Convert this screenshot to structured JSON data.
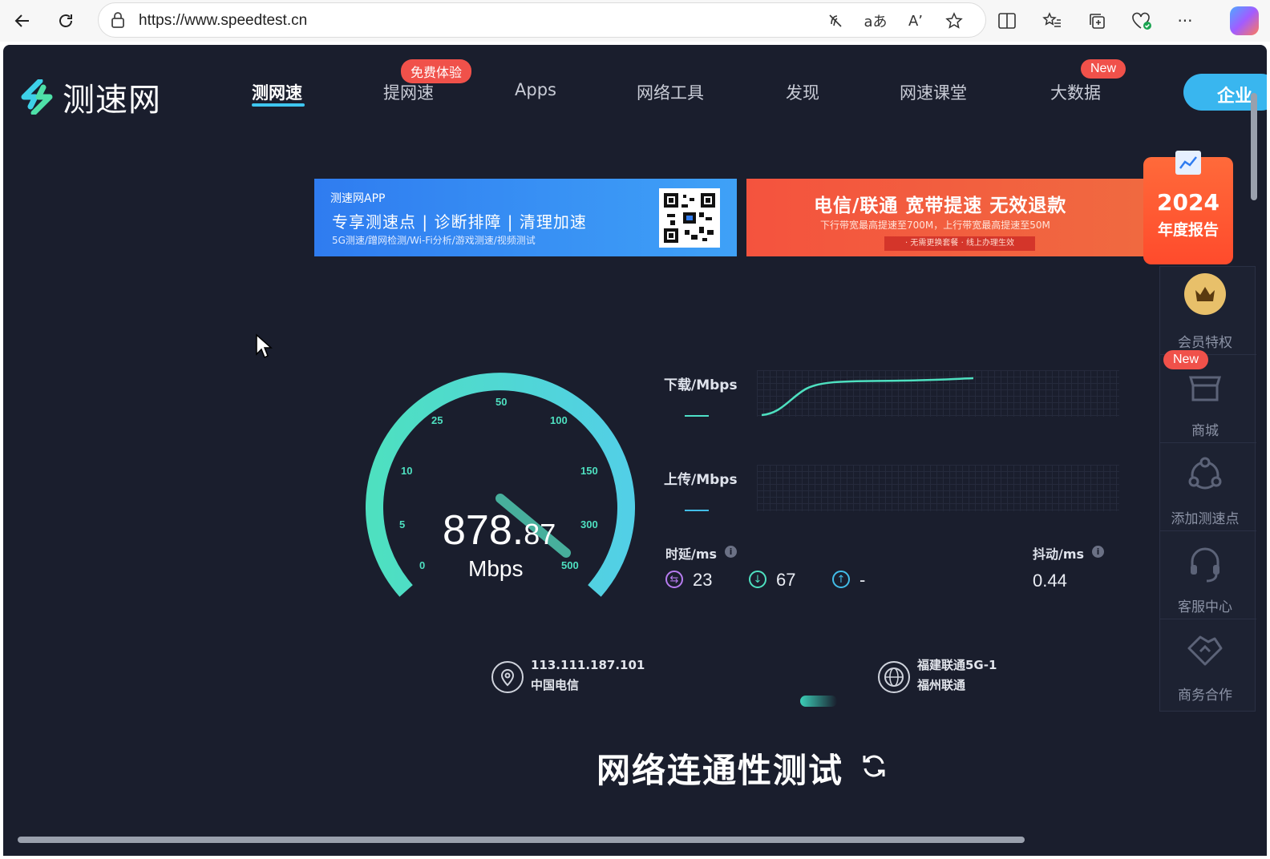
{
  "browser": {
    "url": "https://www.speedtest.cn",
    "icons": [
      "back-icon",
      "refresh-icon",
      "lock-icon",
      "tracking-icon",
      "translate-icon",
      "read-aloud-icon",
      "favorite-icon",
      "split-screen-icon",
      "favorites-icon",
      "collections-icon",
      "health-icon",
      "more-icon",
      "copilot-icon"
    ],
    "translate_glyph": "aあ",
    "read_glyph": "A’",
    "more_glyph": "···"
  },
  "site": {
    "logo_text": "测速网",
    "nav": [
      "测网速",
      "提网速",
      "Apps",
      "网络工具",
      "发现",
      "网速课堂",
      "大数据"
    ],
    "badge_free": "免费体验",
    "badge_new": "New",
    "enterprise": "企业"
  },
  "banners": {
    "blue": {
      "app": "测速网APP",
      "main": "专享测速点 | 诊断排障 | 清理加速",
      "sub": "5G测速/蹭网检测/Wi-Fi分析/游戏测速/视频测试"
    },
    "red": {
      "main": "电信/联通 宽带提速 无效退款",
      "sub": "下行带宽最高提速至700M，上行带宽最高提速至50M",
      "pill": "· 无需更换套餐   · 线上办理生效"
    },
    "report": {
      "year": "2024",
      "label": "年度报告"
    }
  },
  "side_panel": [
    {
      "label": "会员特权"
    },
    {
      "label": "商城",
      "badge": "New"
    },
    {
      "label": "添加测速点"
    },
    {
      "label": "客服中心"
    },
    {
      "label": "商务合作"
    }
  ],
  "gauge": {
    "ticks": [
      "0",
      "5",
      "10",
      "25",
      "50",
      "100",
      "150",
      "300",
      "500"
    ],
    "speed_int": "878.",
    "speed_dec": "87",
    "unit": "Mbps",
    "colors": {
      "start": "#4ee0c0",
      "end": "#52cfe6"
    }
  },
  "charts": {
    "download_label": "下载/Mbps",
    "upload_label": "上传/Mbps"
  },
  "metrics": {
    "latency_label": "时延/ms",
    "jitter_label": "抖动/ms",
    "latency_idle": "23",
    "latency_down": "67",
    "latency_up": "-",
    "jitter": "0.44",
    "info_glyph": "i"
  },
  "server": {
    "ip": "113.111.187.101",
    "isp": "中国电信",
    "node": "福建联通5G-1",
    "node_city": "福州联通"
  },
  "section": {
    "title": "网络连通性测试"
  }
}
